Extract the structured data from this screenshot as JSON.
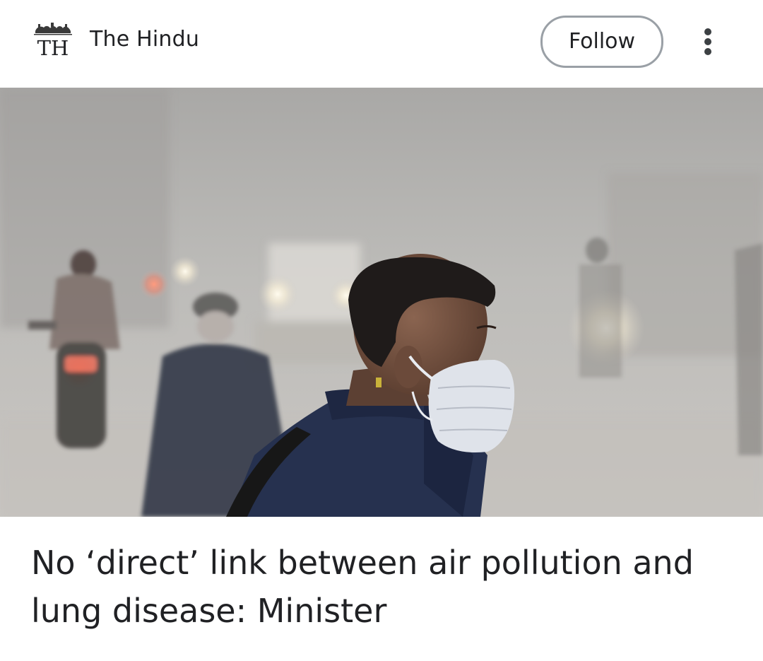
{
  "publisher": {
    "name": "The Hindu",
    "logo_text": "TH"
  },
  "header": {
    "follow_label": "Follow",
    "more_icon": "more-vert-icon"
  },
  "article": {
    "headline": "No ‘direct’ link between air pollution and lung disease: Minister"
  },
  "colors": {
    "text": "#202124",
    "button_border": "#9aa0a6",
    "background": "#ffffff",
    "smog": "#c8c7c3"
  }
}
